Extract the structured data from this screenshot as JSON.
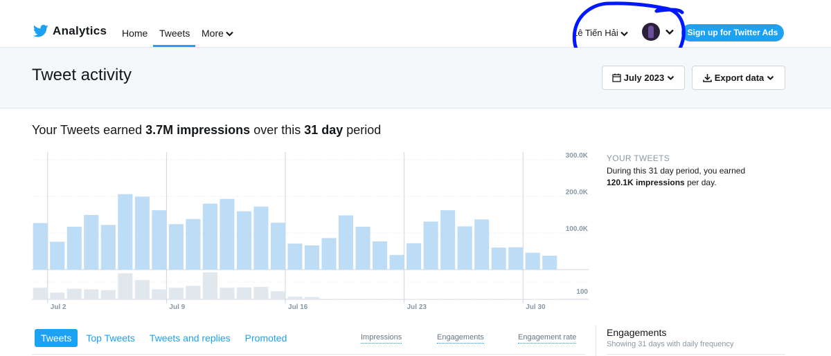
{
  "nav": {
    "brand": "Analytics",
    "links": [
      "Home",
      "Tweets",
      "More"
    ],
    "user_name": "Lê Tiến Hải",
    "ads_button": "Sign up for Twitter Ads"
  },
  "header": {
    "title": "Tweet activity",
    "date_button": "July 2023",
    "export_button": "Export data"
  },
  "summary": {
    "prefix": "Your Tweets earned ",
    "impressions": "3.7M impressions",
    "middle": " over this ",
    "period": "31 day",
    "suffix": " period"
  },
  "side": {
    "title": "YOUR TWEETS",
    "line1": "During this 31 day period, you earned",
    "highlight": "120.1K impressions",
    "line2": " per day."
  },
  "tabs": [
    "Tweets",
    "Top Tweets",
    "Tweets and replies",
    "Promoted"
  ],
  "metrics": [
    "Impressions",
    "Engagements",
    "Engagement rate"
  ],
  "engagements": {
    "title": "Engagements",
    "subtitle": "Showing 31 days with daily frequency"
  },
  "colors": {
    "accent": "#1da1f2",
    "bar_impressions": "#bddcf5",
    "bar_engagements": "#e1e8ed"
  },
  "chart_data": {
    "type": "bar",
    "x_tick_labels": [
      "Jul 2",
      "Jul 9",
      "Jul 16",
      "Jul 23",
      "Jul 30"
    ],
    "y_tick_labels": [
      "100.0K",
      "200.0K",
      "300.0K"
    ],
    "y2_tick_labels": [
      "100"
    ],
    "ylim": [
      0,
      300000
    ],
    "grid": true,
    "series": [
      {
        "values": [
          127000,
          76000,
          117000,
          149000,
          122000,
          206000,
          199000,
          162000,
          124000,
          138000,
          180000,
          193000,
          159000,
          172000,
          128000,
          71000,
          66000,
          86000,
          148000,
          117000,
          77000,
          40000,
          72000,
          131000,
          162000,
          118000,
          137000,
          60000,
          61000,
          46000,
          38000
        ]
      },
      {
        "values": [
          60,
          35,
          55,
          52,
          48,
          135,
          100,
          52,
          60,
          70,
          140,
          60,
          62,
          65,
          42,
          14,
          12,
          2,
          2,
          2,
          2,
          2,
          2,
          2,
          2,
          2,
          2,
          2,
          2,
          2,
          2
        ]
      }
    ]
  }
}
